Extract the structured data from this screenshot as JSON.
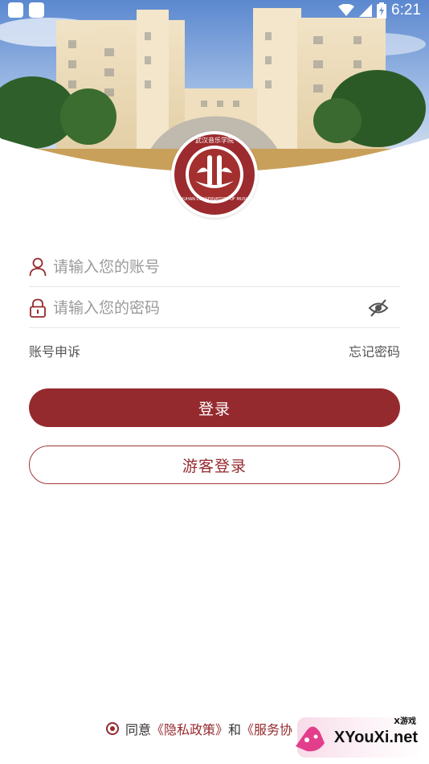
{
  "status_bar": {
    "time": "6:21"
  },
  "logo": {
    "text_cn": "武汉音乐学院",
    "text_en": "WUHAN CONSERVATORY OF MUSIC"
  },
  "form": {
    "account_placeholder": "请输入您的账号",
    "password_placeholder": "请输入您的密码"
  },
  "links": {
    "appeal": "账号申诉",
    "forgot": "忘记密码"
  },
  "buttons": {
    "login": "登录",
    "guest_login": "游客登录"
  },
  "agreement": {
    "prefix": "同意",
    "privacy": "《隐私政策》",
    "and": "和",
    "service": "《服务协"
  },
  "watermark": {
    "top": "X游戏",
    "brand": "XYouXi.net"
  },
  "colors": {
    "accent": "#952a2e"
  }
}
